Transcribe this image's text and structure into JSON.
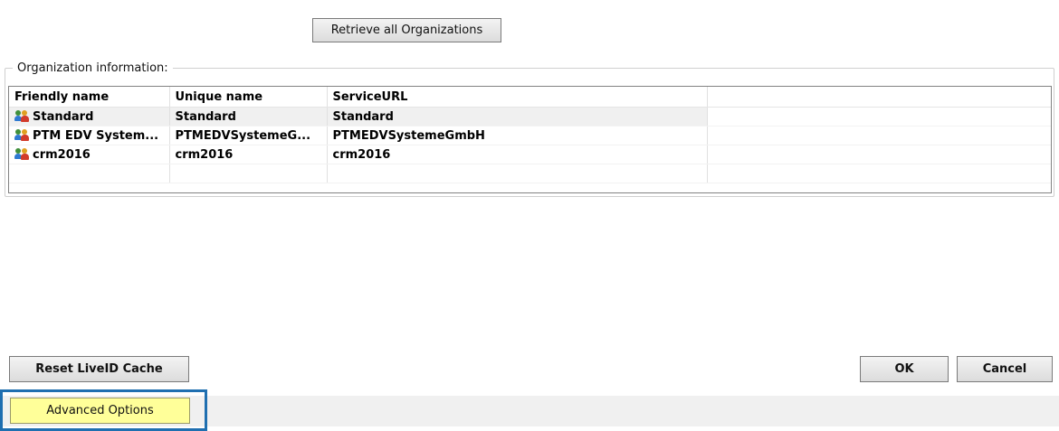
{
  "toolbar": {
    "retrieve_label": "Retrieve all Organizations"
  },
  "org_group": {
    "legend": "Organization information:",
    "columns": [
      "Friendly name",
      "Unique name",
      "ServiceURL",
      ""
    ],
    "rows": [
      {
        "friendly": "Standard",
        "unique": "Standard",
        "service": "Standard",
        "icon": "users-icon"
      },
      {
        "friendly": "PTM EDV System...",
        "unique": "PTMEDVSystemeG...",
        "service": "PTMEDVSystemeGmbH",
        "icon": "users-icon"
      },
      {
        "friendly": "crm2016",
        "unique": "crm2016",
        "service": "crm2016",
        "icon": "users-icon"
      }
    ]
  },
  "actions": {
    "reset_label": "Reset LiveID Cache",
    "ok_label": "OK",
    "cancel_label": "Cancel",
    "advanced_label": "Advanced Options"
  },
  "colors": {
    "highlight_frame": "#1f6fb0",
    "advanced_button": "#ffff99"
  }
}
